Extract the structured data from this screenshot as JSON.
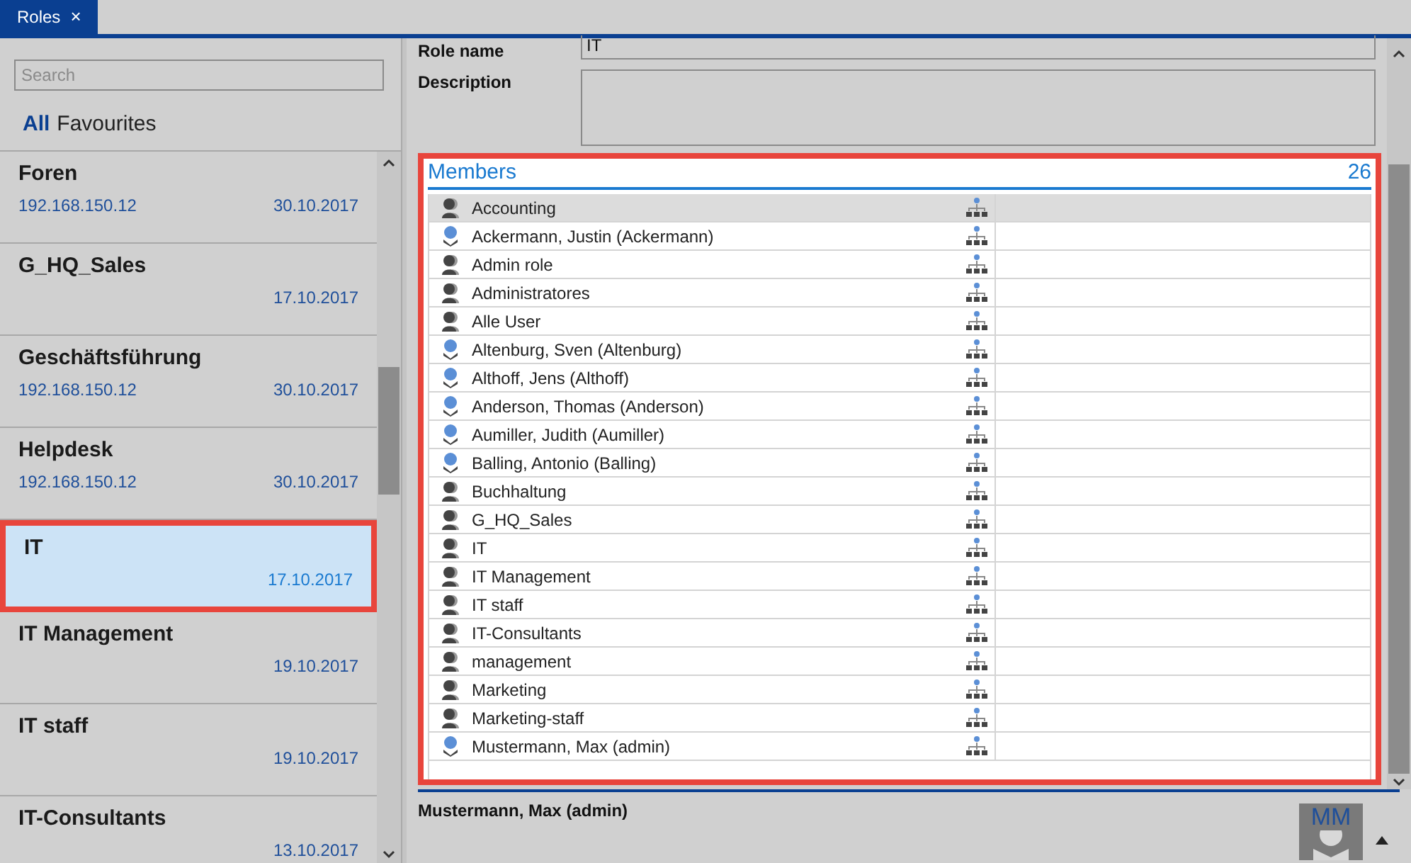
{
  "tabs": [
    {
      "label": "Roles",
      "close": "×",
      "selected": true
    }
  ],
  "search": {
    "placeholder": "Search"
  },
  "filters": [
    {
      "label": "All",
      "selected": true
    },
    {
      "label": "Favourites",
      "selected": false
    }
  ],
  "roles": [
    {
      "name": "Foren",
      "ip": "192.168.150.12",
      "date": "30.10.2017",
      "selected": false,
      "highlighted": false
    },
    {
      "name": "G_HQ_Sales",
      "date": "17.10.2017",
      "selected": false,
      "highlighted": false
    },
    {
      "name": "Geschäftsführung",
      "ip": "192.168.150.12",
      "date": "30.10.2017",
      "selected": false,
      "highlighted": false
    },
    {
      "name": "Helpdesk",
      "ip": "192.168.150.12",
      "date": "30.10.2017",
      "selected": false,
      "highlighted": false
    },
    {
      "name": "IT",
      "date": "17.10.2017",
      "selected": true,
      "highlighted": true
    },
    {
      "name": "IT Management",
      "date": "19.10.2017",
      "selected": false,
      "highlighted": false
    },
    {
      "name": "IT staff",
      "date": "19.10.2017",
      "selected": false,
      "highlighted": false
    },
    {
      "name": "IT-Consultants",
      "date": "13.10.2017",
      "selected": false,
      "highlighted": false
    }
  ],
  "details": {
    "role_name_label": "Role name",
    "role_name": "IT",
    "description_label": "Description"
  },
  "members": {
    "title": "Members",
    "count": "26",
    "highlighted": true,
    "rows": [
      {
        "name": "Accounting",
        "kind": "role",
        "selected": true
      },
      {
        "name": "Ackermann, Justin (Ackermann)",
        "kind": "user",
        "selected": false
      },
      {
        "name": "Admin role",
        "kind": "role",
        "selected": false
      },
      {
        "name": "Administratores",
        "kind": "role",
        "selected": false
      },
      {
        "name": "Alle User",
        "kind": "role",
        "selected": false
      },
      {
        "name": "Altenburg, Sven (Altenburg)",
        "kind": "user",
        "selected": false
      },
      {
        "name": "Althoff, Jens (Althoff)",
        "kind": "user",
        "selected": false
      },
      {
        "name": "Anderson, Thomas (Anderson)",
        "kind": "user",
        "selected": false
      },
      {
        "name": "Aumiller, Judith (Aumiller)",
        "kind": "user",
        "selected": false
      },
      {
        "name": "Balling, Antonio (Balling)",
        "kind": "user",
        "selected": false
      },
      {
        "name": "Buchhaltung",
        "kind": "role",
        "selected": false
      },
      {
        "name": "G_HQ_Sales",
        "kind": "role",
        "selected": false
      },
      {
        "name": "IT",
        "kind": "role",
        "selected": false
      },
      {
        "name": "IT Management",
        "kind": "role",
        "selected": false
      },
      {
        "name": "IT staff",
        "kind": "role",
        "selected": false
      },
      {
        "name": "IT-Consultants",
        "kind": "role",
        "selected": false
      },
      {
        "name": "management",
        "kind": "role",
        "selected": false
      },
      {
        "name": "Marketing",
        "kind": "role",
        "selected": false
      },
      {
        "name": "Marketing-staff",
        "kind": "role",
        "selected": false
      },
      {
        "name": "Mustermann, Max (admin)",
        "kind": "user",
        "selected": false
      }
    ]
  },
  "footer": {
    "user": "Mustermann, Max (admin)",
    "initials": "MM"
  }
}
